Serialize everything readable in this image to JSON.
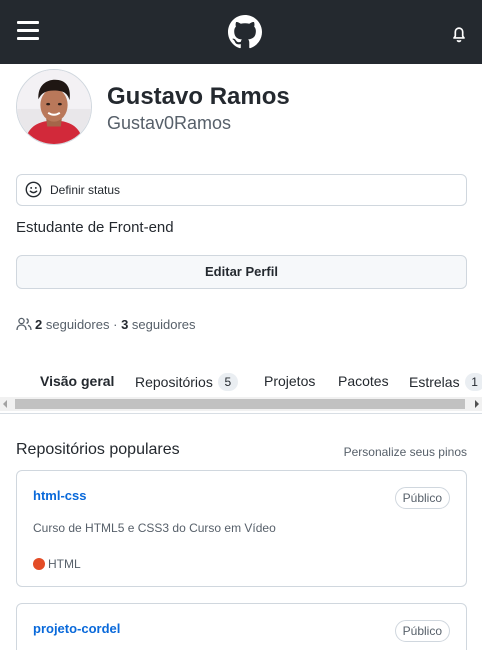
{
  "header": {
    "menu_icon": "hamburger-icon",
    "logo_icon": "github-mark-icon",
    "notification_icon": "bell-icon",
    "bg_color": "#24292f"
  },
  "profile": {
    "name": "Gustavo Ramos",
    "login": "Gustav0Ramos",
    "status_label": "Definir status",
    "bio": "Estudante de Front-end",
    "edit_button": "Editar Perfil",
    "followers_count": "2",
    "followers_label": "seguidores",
    "separator": "·",
    "following_count": "3",
    "following_label": "seguidores"
  },
  "tabs": [
    {
      "label": "Visão geral",
      "active": true
    },
    {
      "label": "Repositórios",
      "count": "5"
    },
    {
      "label": "Projetos"
    },
    {
      "label": "Pacotes"
    },
    {
      "label": "Estrelas",
      "count": "1"
    }
  ],
  "popular": {
    "title": "Repositórios populares",
    "customize_label": "Personalize seus pinos",
    "repos": [
      {
        "name": "html-css",
        "visibility": "Público",
        "description": "Curso de HTML5 e CSS3 do Curso em Vídeo",
        "language": "HTML",
        "language_color": "#e34c26"
      },
      {
        "name": "projeto-cordel",
        "visibility": "Público"
      }
    ]
  },
  "colors": {
    "link": "#0969da",
    "muted": "#57606a",
    "border": "#d0d7de"
  }
}
